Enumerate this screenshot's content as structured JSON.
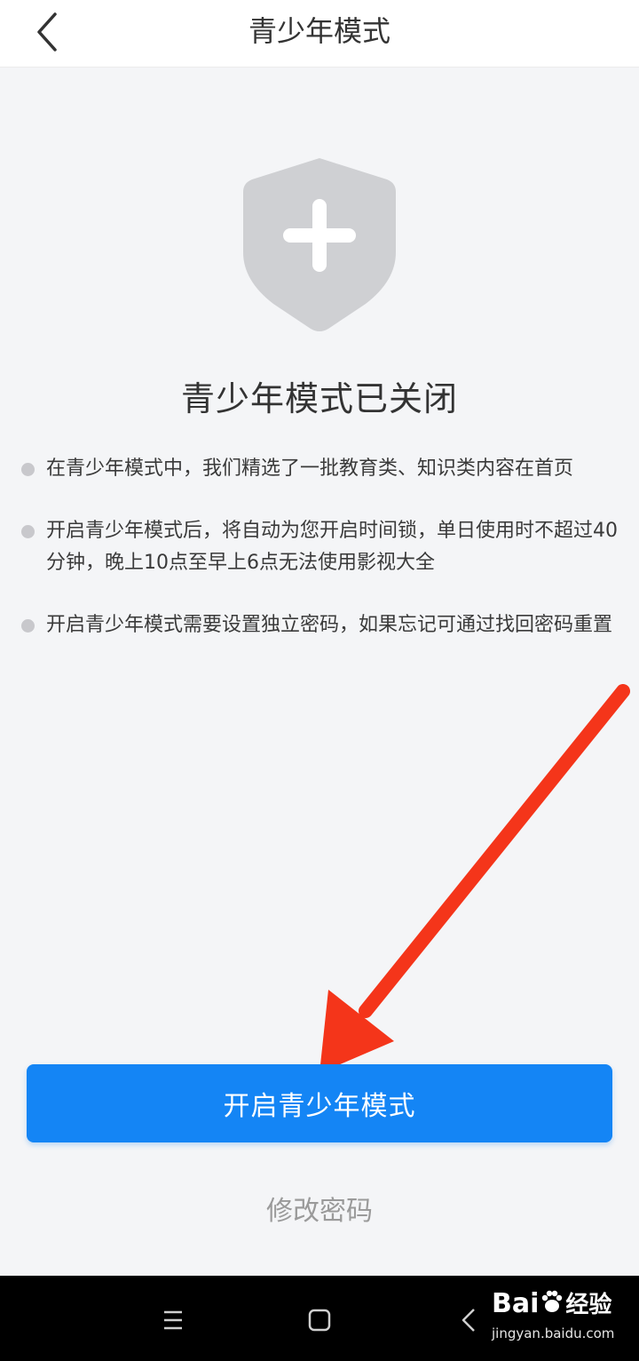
{
  "header": {
    "title": "青少年模式"
  },
  "status": {
    "title": "青少年模式已关闭"
  },
  "info": {
    "items": [
      "在青少年模式中，我们精选了一批教育类、知识类内容在首页",
      "开启青少年模式后，将自动为您开启时间锁，单日使用时不超过40分钟，晚上10点至早上6点无法使用影视大全",
      "开启青少年模式需要设置独立密码，如果忘记可通过找回密码重置"
    ]
  },
  "actions": {
    "enable_label": "开启青少年模式",
    "change_password_label": "修改密码"
  },
  "watermark": {
    "logo_text": "Bai",
    "logo_cn": "经验",
    "url": "jingyan.baidu.com"
  },
  "colors": {
    "primary": "#1485f5",
    "arrow": "#f4351a",
    "shield": "#cfd0d3"
  },
  "icons": [
    "back-chevron-icon",
    "shield-plus-icon",
    "menu-icon",
    "home-icon",
    "nav-back-icon",
    "baidu-paw-icon"
  ]
}
